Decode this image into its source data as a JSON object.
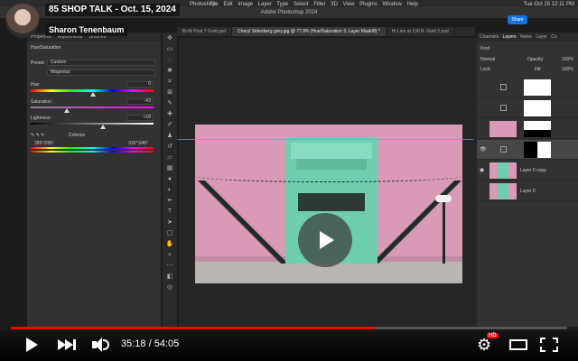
{
  "video": {
    "title": "85 SHOP TALK - Oct. 15, 2024",
    "channel": "Sharon Tenenbaum",
    "current_time": "35:18",
    "duration": "54:05",
    "time_separator": " / ",
    "progress_fraction": 0.653,
    "hd_badge": "HD",
    "progress_color": "#ff0000"
  },
  "macbar": {
    "app": "Photoshop",
    "menus": "File  Edit  Image  Layer  Type  Select  Filter  3D  View  Plugins  Window  Help",
    "clock": "Tue Oct 15 12:11 PM"
  },
  "photoshop": {
    "window_title": "Adobe Photoshop 2024",
    "share_label": "Share",
    "tabs": [
      "B+W Post 7 Gold.psd",
      "Cheryl Sidenberg grey.jpg @ 77.9% (Hue/Saturation 3, Layer Mask/8) *",
      "Hi Line at 190 R. Gold 2.psd"
    ],
    "properties": {
      "tabs": "Properties  Adjustments  Brushes",
      "panel_name": "Hue/Saturation",
      "preset_label": "Preset:",
      "preset_value": "Custom",
      "channel_value": "Magentas",
      "hue_label": "Hue:",
      "hue_value": "0",
      "saturation_label": "Saturation:",
      "saturation_value": "-43",
      "lightness_label": "Lightness:",
      "lightness_value": "+18",
      "colorize_label": "Colorize",
      "range_left": "285°/295°",
      "range_right": "315°\\345°"
    },
    "layers": {
      "tabs": [
        "Channels",
        "Layers",
        "Notes",
        "Layer Co"
      ],
      "active_tab": "Layers",
      "kind_label": "Kind",
      "blend_mode": "Normal",
      "opacity_label": "Opacity:",
      "opacity_value": "100%",
      "lock_label": "Lock:",
      "fill_label": "Fill:",
      "fill_value": "100%",
      "rows": [
        "",
        "",
        "",
        "",
        "Layer 0 copy",
        "Layer 0"
      ]
    }
  },
  "colors": {
    "accent_blue": "#1473e6",
    "ps_panel": "#323232",
    "photo_pink": "#d99ab7",
    "kiosk_mint": "#6fcdb0"
  },
  "icons": {
    "play": "play-icon",
    "next": "next-icon",
    "volume": "volume-icon",
    "settings": "gear-icon",
    "theater": "theater-mode-icon",
    "fullscreen": "fullscreen-icon"
  }
}
